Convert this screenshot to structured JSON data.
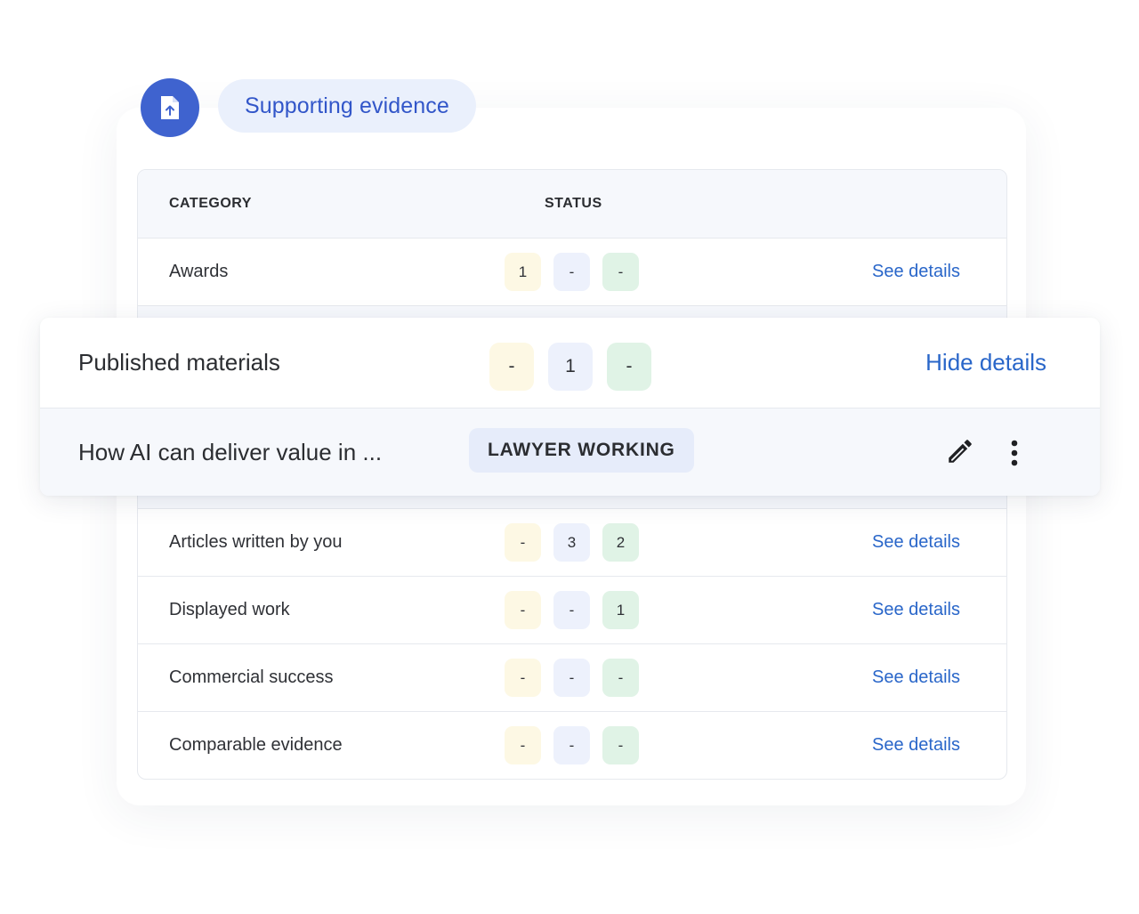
{
  "section": {
    "title": "Supporting evidence",
    "icon": "file-upload-icon"
  },
  "table": {
    "headers": {
      "category": "CATEGORY",
      "status": "STATUS"
    },
    "rows": [
      {
        "category": "Awards",
        "counts": [
          "1",
          "-",
          "-"
        ],
        "action": "See details"
      },
      {
        "category": "Articles written by you",
        "counts": [
          "-",
          "3",
          "2"
        ],
        "action": "See details"
      },
      {
        "category": "Displayed work",
        "counts": [
          "-",
          "-",
          "1"
        ],
        "action": "See details"
      },
      {
        "category": "Commercial success",
        "counts": [
          "-",
          "-",
          "-"
        ],
        "action": "See details"
      },
      {
        "category": "Comparable evidence",
        "counts": [
          "-",
          "-",
          "-"
        ],
        "action": "See details"
      }
    ]
  },
  "expanded": {
    "category": "Published materials",
    "counts": [
      "-",
      "1",
      "-"
    ],
    "action": "Hide details",
    "item": {
      "title": "How AI can deliver value in ...",
      "status": "LAWYER WORKING",
      "edit_icon": "pencil-icon",
      "more_icon": "more-vertical-icon"
    }
  },
  "colors": {
    "accent": "#3f63cf",
    "link": "#2966c9",
    "chip_yellow": "#fdf8e4",
    "chip_blue": "#edf1fc",
    "chip_green": "#e0f3e6"
  }
}
